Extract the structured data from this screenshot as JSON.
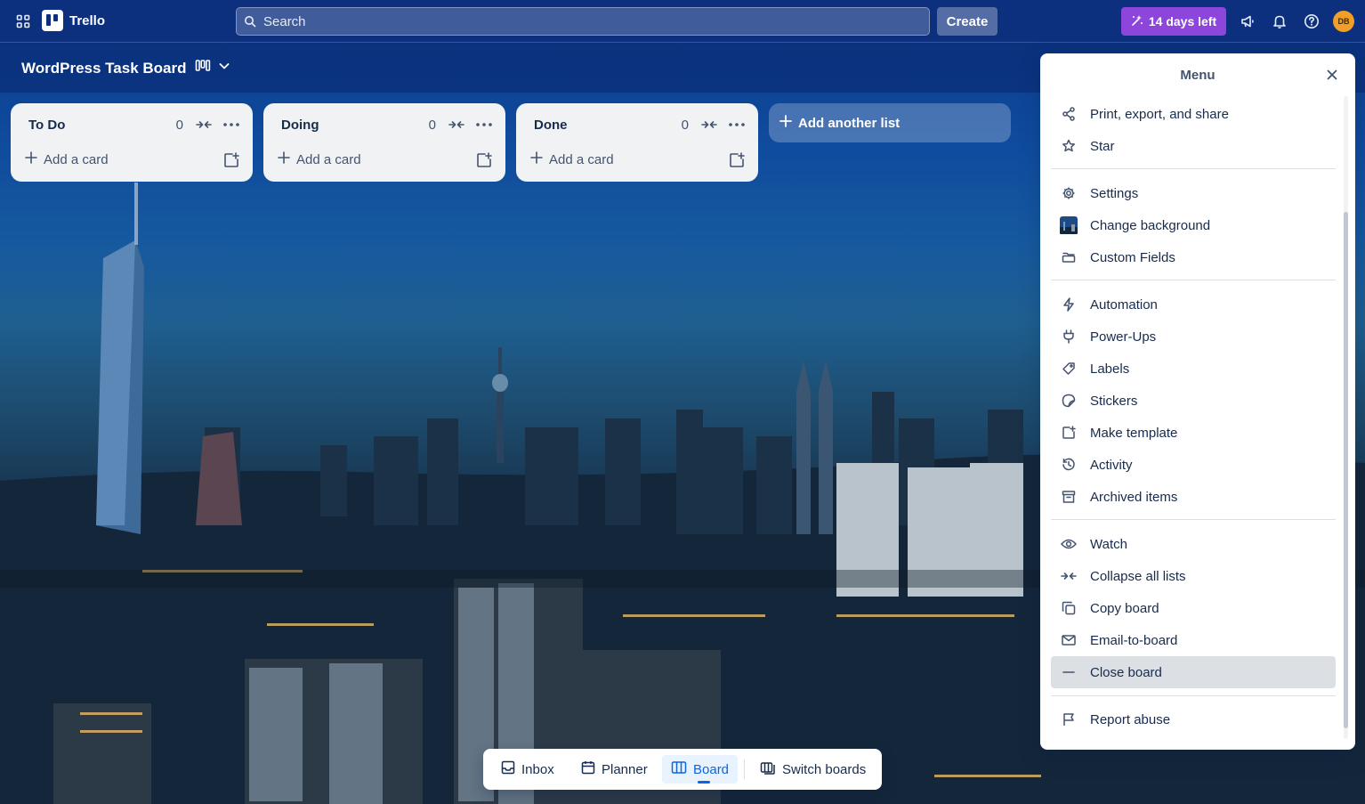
{
  "app": {
    "name": "Trello"
  },
  "topnav": {
    "search_placeholder": "Search",
    "create_label": "Create",
    "trial_label": "14 days left",
    "avatar_initials": "DB"
  },
  "board": {
    "title": "WordPress Task Board"
  },
  "lists": [
    {
      "title": "To Do",
      "count": "0",
      "add_label": "Add a card"
    },
    {
      "title": "Doing",
      "count": "0",
      "add_label": "Add a card"
    },
    {
      "title": "Done",
      "count": "0",
      "add_label": "Add a card"
    }
  ],
  "add_list_label": "Add another list",
  "menu": {
    "title": "Menu",
    "items": [
      {
        "label": "Print, export, and share",
        "icon": "share-icon"
      },
      {
        "label": "Star",
        "icon": "star-icon"
      },
      {
        "label": "Settings",
        "icon": "gear-icon"
      },
      {
        "label": "Change background",
        "icon": "background-thumbnail-icon"
      },
      {
        "label": "Custom Fields",
        "icon": "custom-fields-icon"
      },
      {
        "label": "Automation",
        "icon": "lightning-icon"
      },
      {
        "label": "Power-Ups",
        "icon": "plug-icon"
      },
      {
        "label": "Labels",
        "icon": "tag-icon"
      },
      {
        "label": "Stickers",
        "icon": "sticker-icon"
      },
      {
        "label": "Make template",
        "icon": "template-icon"
      },
      {
        "label": "Activity",
        "icon": "history-icon"
      },
      {
        "label": "Archived items",
        "icon": "archive-icon"
      },
      {
        "label": "Watch",
        "icon": "eye-icon"
      },
      {
        "label": "Collapse all lists",
        "icon": "collapse-icon"
      },
      {
        "label": "Copy board",
        "icon": "copy-icon"
      },
      {
        "label": "Email-to-board",
        "icon": "mail-icon"
      },
      {
        "label": "Close board",
        "icon": "minus-icon"
      },
      {
        "label": "Report abuse",
        "icon": "flag-icon"
      }
    ]
  },
  "bottombar": {
    "inbox": "Inbox",
    "planner": "Planner",
    "board": "Board",
    "switch": "Switch boards"
  },
  "colors": {
    "nav": "#0c2f7e",
    "trial": "#8c46dc",
    "avatar": "#f29f27",
    "active": "#0c66e4"
  }
}
